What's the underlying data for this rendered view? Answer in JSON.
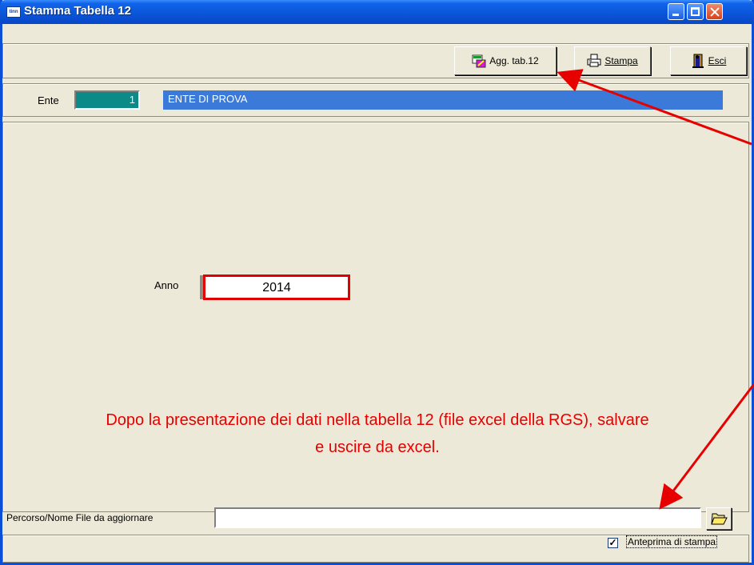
{
  "window": {
    "title": "Stamma Tabella 12"
  },
  "toolbar": {
    "agg_label": "Agg. tab.12",
    "stampa_label": "Stampa",
    "esci_label": "Esci"
  },
  "ente": {
    "label": "Ente",
    "code": "1",
    "name": "ENTE DI PROVA"
  },
  "anno": {
    "label": "Anno",
    "value": "2014"
  },
  "note": {
    "line1": "Dopo la presentazione dei dati nella tabella 12 (file excel della RGS), salvare",
    "line2": "e uscire da excel."
  },
  "file": {
    "label": "Percorso/Nome File da aggiornare",
    "value": ""
  },
  "preview": {
    "label": "Anteprima di stampa",
    "checked": true
  },
  "colors": {
    "annotation": "#e60000",
    "titlebar": "#0a54d8",
    "ente_code_bg": "#0b8a87",
    "ente_name_bg": "#3b7ad9"
  },
  "icons": [
    "app-icon",
    "excel-update-icon",
    "printer-icon",
    "exit-door-icon",
    "folder-open-icon",
    "minimize-icon",
    "maximize-icon",
    "close-icon"
  ]
}
